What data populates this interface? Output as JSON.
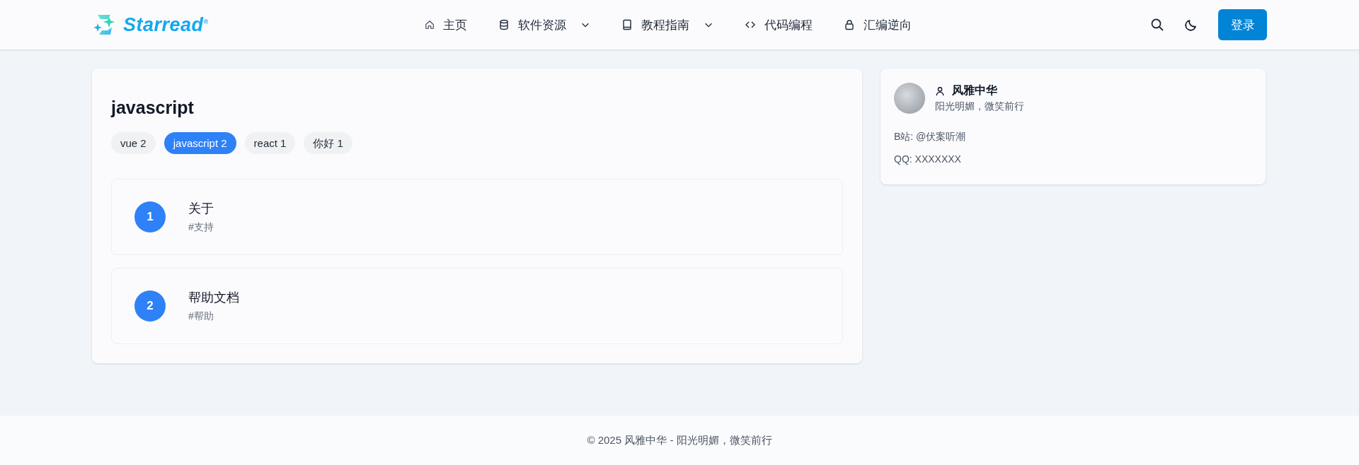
{
  "header": {
    "logo": "Starread$^{®}$",
    "nav": [
      {
        "kind": "home",
        "label": "主页",
        "dropdown": false
      },
      {
        "kind": "database",
        "label": "软件资源",
        "dropdown": true
      },
      {
        "kind": "book",
        "label": "教程指南",
        "dropdown": true
      },
      {
        "kind": "code",
        "label": "代码编程",
        "dropdown": false
      },
      {
        "kind": "lock",
        "label": "汇编逆向",
        "dropdown": false
      }
    ],
    "login": "登录"
  },
  "main": {
    "title": "javascript",
    "tags": [
      {
        "label": "vue 2",
        "selected": false
      },
      {
        "label": "javascript 2",
        "selected": true
      },
      {
        "label": "react 1",
        "selected": false
      },
      {
        "label": "你好 1",
        "selected": false
      }
    ],
    "posts": [
      {
        "number": "1",
        "title": "关于",
        "tag": "#支持"
      },
      {
        "number": "2",
        "title": "帮助文档",
        "tag": "#帮助"
      }
    ]
  },
  "profile": {
    "name": "风雅中华",
    "motto": "阳光明媚，微笑前行",
    "lines": [
      "B站: @伏案听潮",
      "QQ: XXXXXXX"
    ]
  },
  "footer": "© 2025 风雅中华 - 阳光明媚，微笑前行"
}
